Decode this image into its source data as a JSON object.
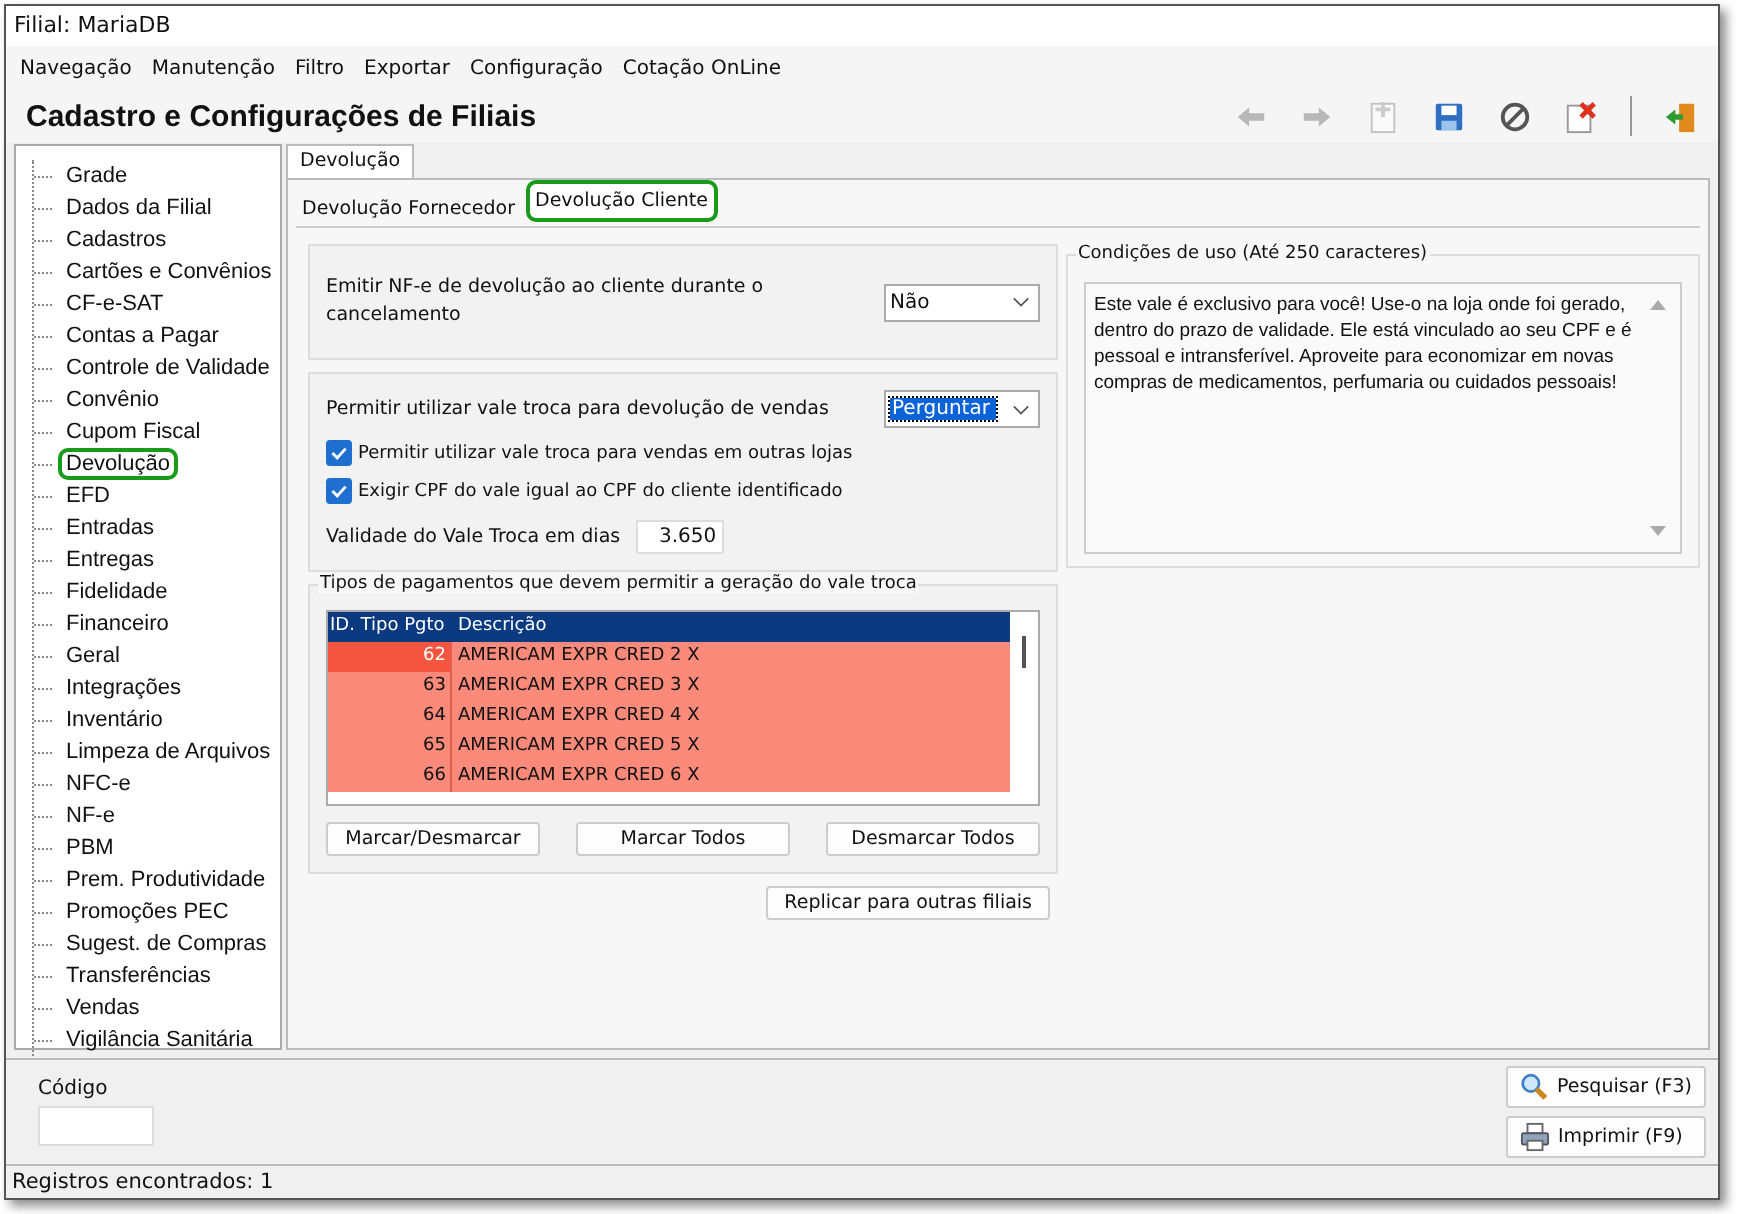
{
  "window": {
    "title": "Filial: MariaDB"
  },
  "menu": [
    "Navegação",
    "Manutenção",
    "Filtro",
    "Exportar",
    "Configuração",
    "Cotação OnLine"
  ],
  "header": {
    "title": "Cadastro e Configurações de Filiais"
  },
  "toolbar": [
    {
      "kind": "back",
      "disabled": true
    },
    {
      "kind": "forward",
      "disabled": true
    },
    {
      "kind": "new",
      "disabled": true
    },
    {
      "kind": "save",
      "disabled": false
    },
    {
      "kind": "cancel",
      "disabled": false
    },
    {
      "kind": "delete",
      "disabled": false
    },
    {
      "kind": "exit",
      "disabled": false
    }
  ],
  "sidebar": {
    "items": [
      {
        "label": "Grade",
        "selected": false
      },
      {
        "label": "Dados da Filial",
        "selected": false
      },
      {
        "label": "Cadastros",
        "selected": false
      },
      {
        "label": "Cartões e Convênios",
        "selected": false
      },
      {
        "label": "CF-e-SAT",
        "selected": false
      },
      {
        "label": "Contas a Pagar",
        "selected": false
      },
      {
        "label": "Controle de Validade",
        "selected": false
      },
      {
        "label": "Convênio",
        "selected": false
      },
      {
        "label": "Cupom Fiscal",
        "selected": false
      },
      {
        "label": "Devolução",
        "selected": true
      },
      {
        "label": "EFD",
        "selected": false
      },
      {
        "label": "Entradas",
        "selected": false
      },
      {
        "label": "Entregas",
        "selected": false
      },
      {
        "label": "Fidelidade",
        "selected": false
      },
      {
        "label": "Financeiro",
        "selected": false
      },
      {
        "label": "Geral",
        "selected": false
      },
      {
        "label": "Integrações",
        "selected": false
      },
      {
        "label": "Inventário",
        "selected": false
      },
      {
        "label": "Limpeza de Arquivos",
        "selected": false
      },
      {
        "label": "NFC-e",
        "selected": false
      },
      {
        "label": "NF-e",
        "selected": false
      },
      {
        "label": "PBM",
        "selected": false
      },
      {
        "label": "Prem. Produtividade",
        "selected": false
      },
      {
        "label": "Promoções PEC",
        "selected": false
      },
      {
        "label": "Sugest. de Compras",
        "selected": false
      },
      {
        "label": "Transferências",
        "selected": false
      },
      {
        "label": "Vendas",
        "selected": false
      },
      {
        "label": "Vigilância Sanitária",
        "selected": false
      }
    ]
  },
  "tabs": [
    {
      "label": "Devolução",
      "selected": true
    }
  ],
  "subtabs": [
    {
      "label": "Devolução Fornecedor",
      "selected": false
    },
    {
      "label": "Devolução Cliente",
      "selected": true
    }
  ],
  "emit_nfe": {
    "label": "Emitir NF-e de devolução ao cliente  durante o cancelamento",
    "value": "Não",
    "focused": false
  },
  "vale_troca": {
    "label": "Permitir utilizar vale troca para devolução de vendas",
    "value": "Perguntar",
    "focused": true
  },
  "checkboxes": [
    {
      "label": "Permitir utilizar vale troca para vendas em outras lojas",
      "checked": true
    },
    {
      "label": "Exigir CPF do vale igual ao CPF do cliente identificado",
      "checked": true
    }
  ],
  "validade": {
    "label": "Validade do Vale Troca em dias",
    "value": "3.650"
  },
  "payments": {
    "title": "Tipos de pagamentos que devem permitir a geração do vale troca",
    "columns": [
      "ID. Tipo Pgto",
      "Descrição"
    ],
    "rows": [
      {
        "id": "62",
        "description": "AMERICAM EXPR CRED 2 X",
        "selected": true
      },
      {
        "id": "63",
        "description": "AMERICAM EXPR CRED 3 X",
        "selected": false
      },
      {
        "id": "64",
        "description": "AMERICAM EXPR CRED 4 X",
        "selected": false
      },
      {
        "id": "65",
        "description": "AMERICAM EXPR CRED 5 X",
        "selected": false
      },
      {
        "id": "66",
        "description": "AMERICAM EXPR CRED 6 X",
        "selected": false
      }
    ],
    "buttons": [
      "Marcar/Desmarcar",
      "Marcar Todos",
      "Desmarcar Todos"
    ]
  },
  "replicate_button": "Replicar para outras filiais",
  "conditions": {
    "title": "Condições de uso (Até 250 caracteres)",
    "text": "Este vale é exclusivo para você! Use-o na loja onde foi gerado, dentro do prazo de validade. Ele está vinculado ao seu CPF e é pessoal e intransferível. Aproveite para economizar em novas compras de medicamentos, perfumaria ou cuidados pessoais!"
  },
  "footer": {
    "code_label": "Código",
    "buttons": [
      {
        "kind": "search",
        "label": "Pesquisar (F3)"
      },
      {
        "kind": "print",
        "label": "Imprimir (F9)"
      }
    ]
  },
  "status_bar": "Registros encontrados: 1"
}
